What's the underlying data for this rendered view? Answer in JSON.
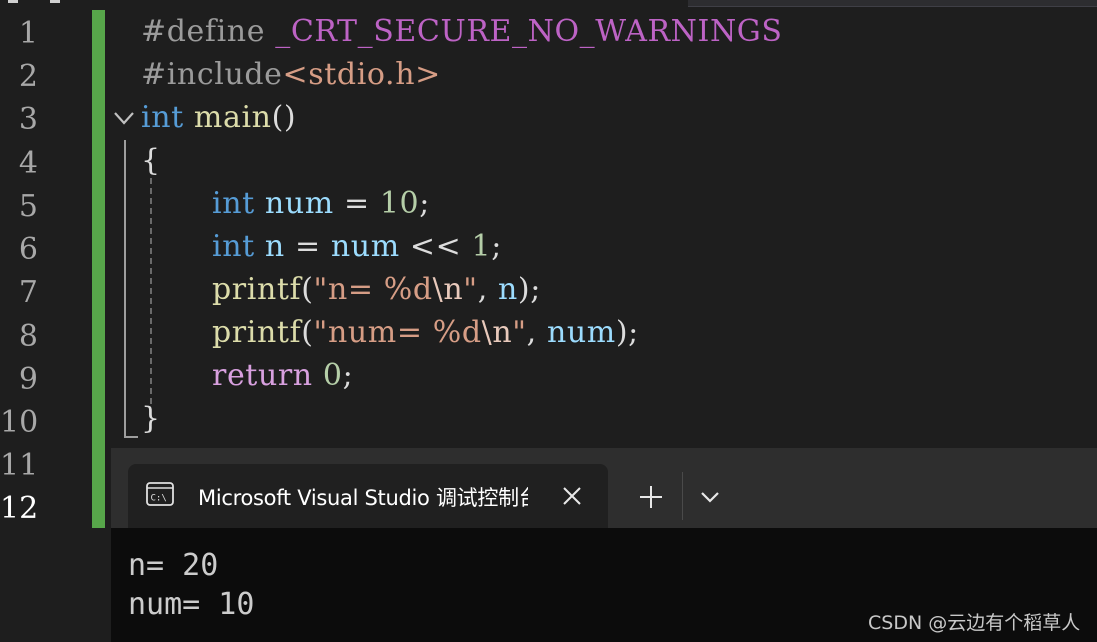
{
  "editor": {
    "line_numbers": [
      "1",
      "2",
      "3",
      "4",
      "5",
      "6",
      "7",
      "8",
      "9",
      "10",
      "11",
      "12"
    ],
    "lines": {
      "l1": {
        "directive": "#define",
        "macro": "_CRT_SECURE_NO_WARNINGS"
      },
      "l2": {
        "directive": "#include",
        "header": "<stdio.h>"
      },
      "l3": {
        "type": "int",
        "name": "main",
        "paren": "()"
      },
      "l4": {
        "brace": "{"
      },
      "l5": {
        "type": "int",
        "var": "num",
        "op": "=",
        "value": "10",
        "semi": ";"
      },
      "l6": {
        "type": "int",
        "var": "n",
        "op": "=",
        "var2": "num",
        "shift": "<<",
        "value": "1",
        "semi": ";"
      },
      "l7": {
        "fn": "printf",
        "open": "(",
        "str_start": "\"n= %d",
        "escape": "\\n",
        "str_end": "\"",
        "comma": ",",
        "arg": "n",
        "close": ");"
      },
      "l8": {
        "fn": "printf",
        "open": "(",
        "str_start": "\"num= %d",
        "escape": "\\n",
        "str_end": "\"",
        "comma": ",",
        "arg": "num",
        "close": ");"
      },
      "l9": {
        "keyword": "return",
        "value": "0",
        "semi": ";"
      },
      "l10": {
        "brace": "}"
      }
    }
  },
  "console": {
    "title": "Microsoft Visual Studio 调试控制台",
    "output": [
      "n= 20",
      "num= 10"
    ],
    "icons": {
      "tab": "cmd-terminal-icon",
      "close": "close-icon",
      "new": "plus-icon",
      "dropdown": "chevron-down-icon"
    }
  },
  "watermark": "CSDN @云边有个稻草人",
  "colors": {
    "keyword": "#569cd6",
    "function": "#dcdcaa",
    "variable": "#9cdcfe",
    "number": "#b5cea8",
    "string": "#d69d85",
    "change_bar": "#57a64a",
    "console_bg": "#0c0c0c"
  }
}
